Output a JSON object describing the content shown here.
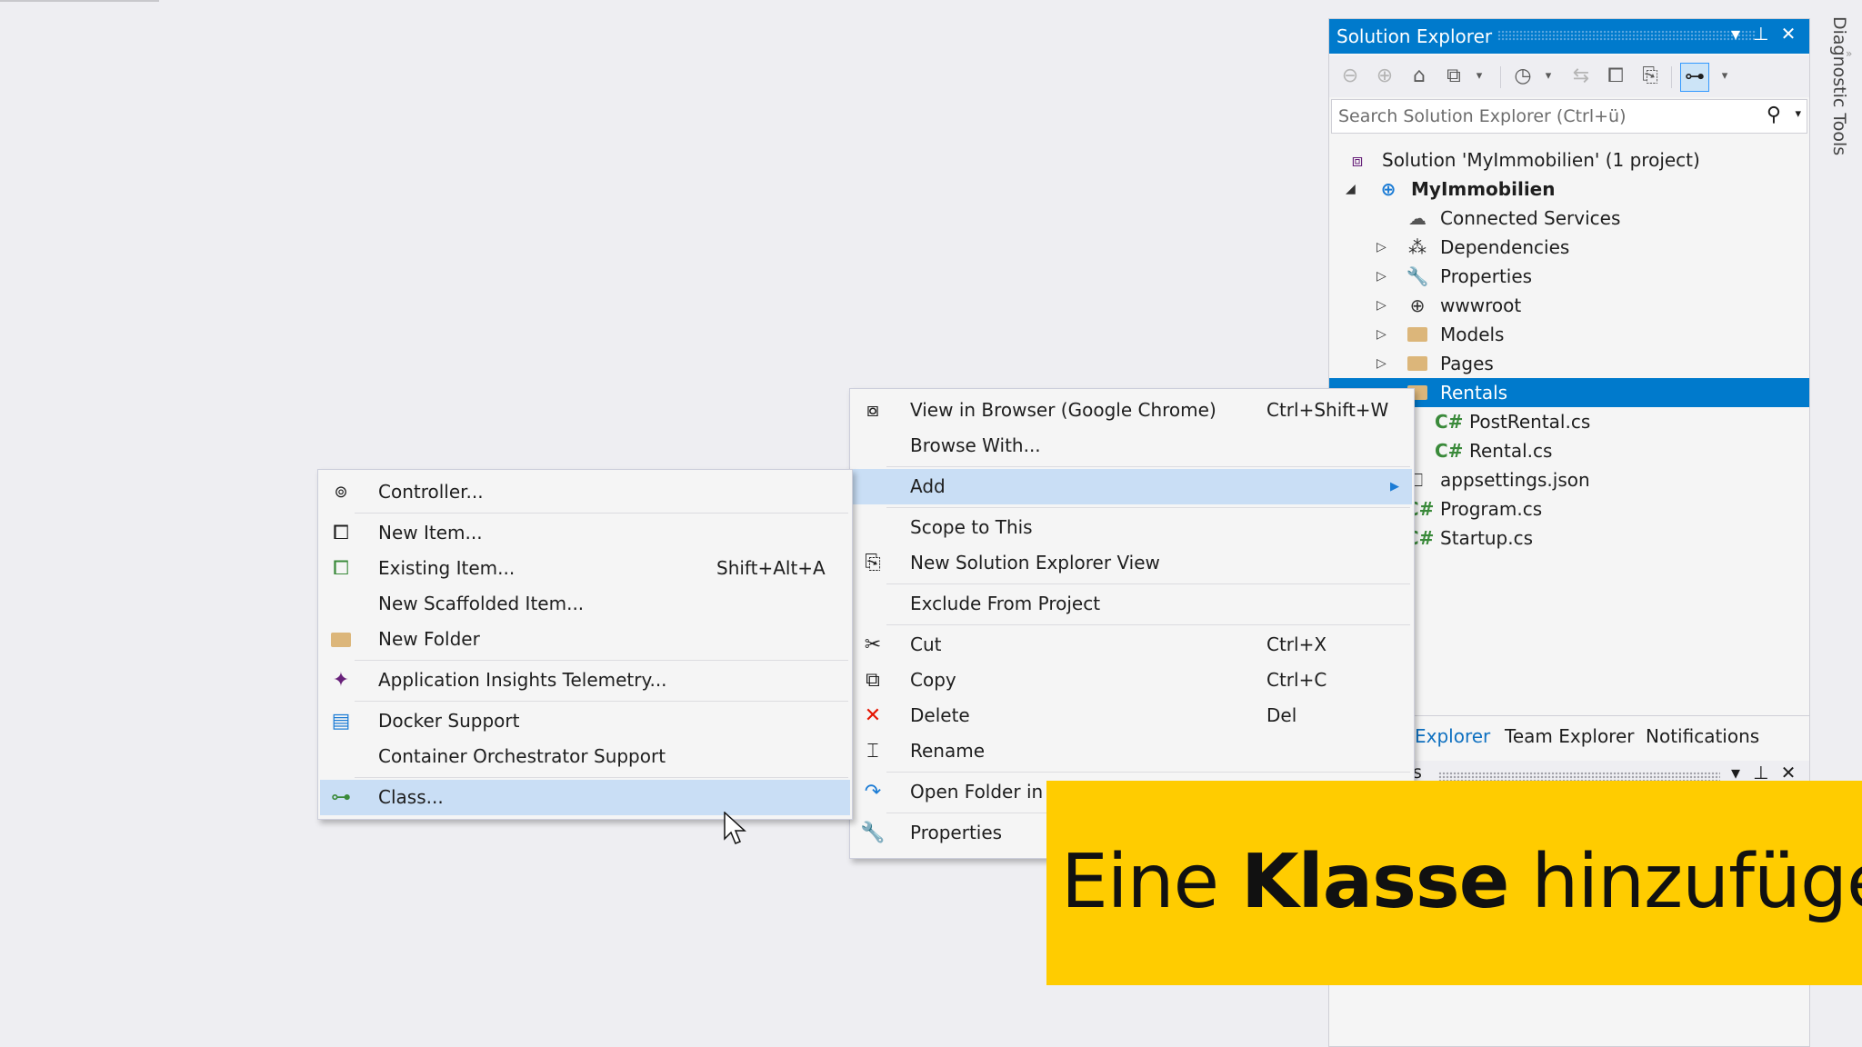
{
  "solution_explorer": {
    "title": "Solution Explorer",
    "search_placeholder": "Search Solution Explorer (Ctrl+ü)",
    "tree": [
      {
        "label": "Solution 'MyImmobilien' (1 project)",
        "icon": "solution-icon"
      },
      {
        "label": "MyImmobilien",
        "icon": "web-project-icon",
        "bold": true
      },
      {
        "label": "Connected Services",
        "icon": "connected-services-icon"
      },
      {
        "label": "Dependencies",
        "icon": "dependencies-icon"
      },
      {
        "label": "Properties",
        "icon": "wrench-icon"
      },
      {
        "label": "wwwroot",
        "icon": "globe-icon"
      },
      {
        "label": "Models",
        "icon": "folder-icon"
      },
      {
        "label": "Pages",
        "icon": "folder-icon"
      },
      {
        "label": "Rentals",
        "icon": "folder-icon",
        "selected": true
      },
      {
        "label": "PostRental.cs",
        "icon": "csharp-icon"
      },
      {
        "label": "Rental.cs",
        "icon": "csharp-icon"
      },
      {
        "label": "appsettings.json",
        "icon": "json-icon"
      },
      {
        "label": "Program.cs",
        "icon": "csharp-icon"
      },
      {
        "label": "Startup.cs",
        "icon": "csharp-icon"
      }
    ],
    "tabs": [
      "Explorer",
      "Team Explorer",
      "Notifications"
    ],
    "tab_prefix_partial": "s"
  },
  "diagnostic_tools": "Diagnostic Tools",
  "context_menu": [
    {
      "label": "View in Browser (Google Chrome)",
      "shortcut": "Ctrl+Shift+W",
      "icon": "browser-icon"
    },
    {
      "label": "Browse With...",
      "shortcut": ""
    },
    {
      "label": "Add",
      "shortcut": "",
      "submenu": true,
      "highlighted": true
    },
    {
      "label": "Scope to This",
      "shortcut": ""
    },
    {
      "label": "New Solution Explorer View",
      "shortcut": "",
      "icon": "new-view-icon"
    },
    {
      "label": "Exclude From Project",
      "shortcut": ""
    },
    {
      "label": "Cut",
      "shortcut": "Ctrl+X",
      "icon": "scissors-icon"
    },
    {
      "label": "Copy",
      "shortcut": "Ctrl+C",
      "icon": "copy-icon"
    },
    {
      "label": "Delete",
      "shortcut": "Del",
      "icon": "delete-icon"
    },
    {
      "label": "Rename",
      "shortcut": "",
      "icon": "rename-icon"
    },
    {
      "label": "Open Folder in",
      "shortcut": "",
      "icon": "open-folder-icon"
    },
    {
      "label": "Properties",
      "shortcut": "",
      "icon": "wrench-icon"
    }
  ],
  "add_submenu": [
    {
      "label": "Controller...",
      "shortcut": "",
      "icon": "controller-icon"
    },
    {
      "label": "New Item...",
      "shortcut": "",
      "icon": "new-item-icon"
    },
    {
      "label": "Existing Item...",
      "shortcut": "Shift+Alt+A",
      "icon": "existing-item-icon"
    },
    {
      "label": "New Scaffolded Item...",
      "shortcut": ""
    },
    {
      "label": "New Folder",
      "shortcut": "",
      "icon": "new-folder-icon"
    },
    {
      "label": "Application Insights Telemetry...",
      "shortcut": "",
      "icon": "insights-icon"
    },
    {
      "label": "Docker Support",
      "shortcut": "",
      "icon": "docker-icon"
    },
    {
      "label": "Container Orchestrator Support",
      "shortcut": ""
    },
    {
      "label": "Class...",
      "shortcut": "",
      "icon": "class-icon",
      "highlighted": true
    }
  ],
  "banner": {
    "word1": "Eine",
    "word2": "Klasse",
    "word3": "hinzufügen"
  },
  "colors": {
    "accent": "#007acc",
    "banner": "#ffcc00",
    "menu_highlight": "#c9def5"
  }
}
